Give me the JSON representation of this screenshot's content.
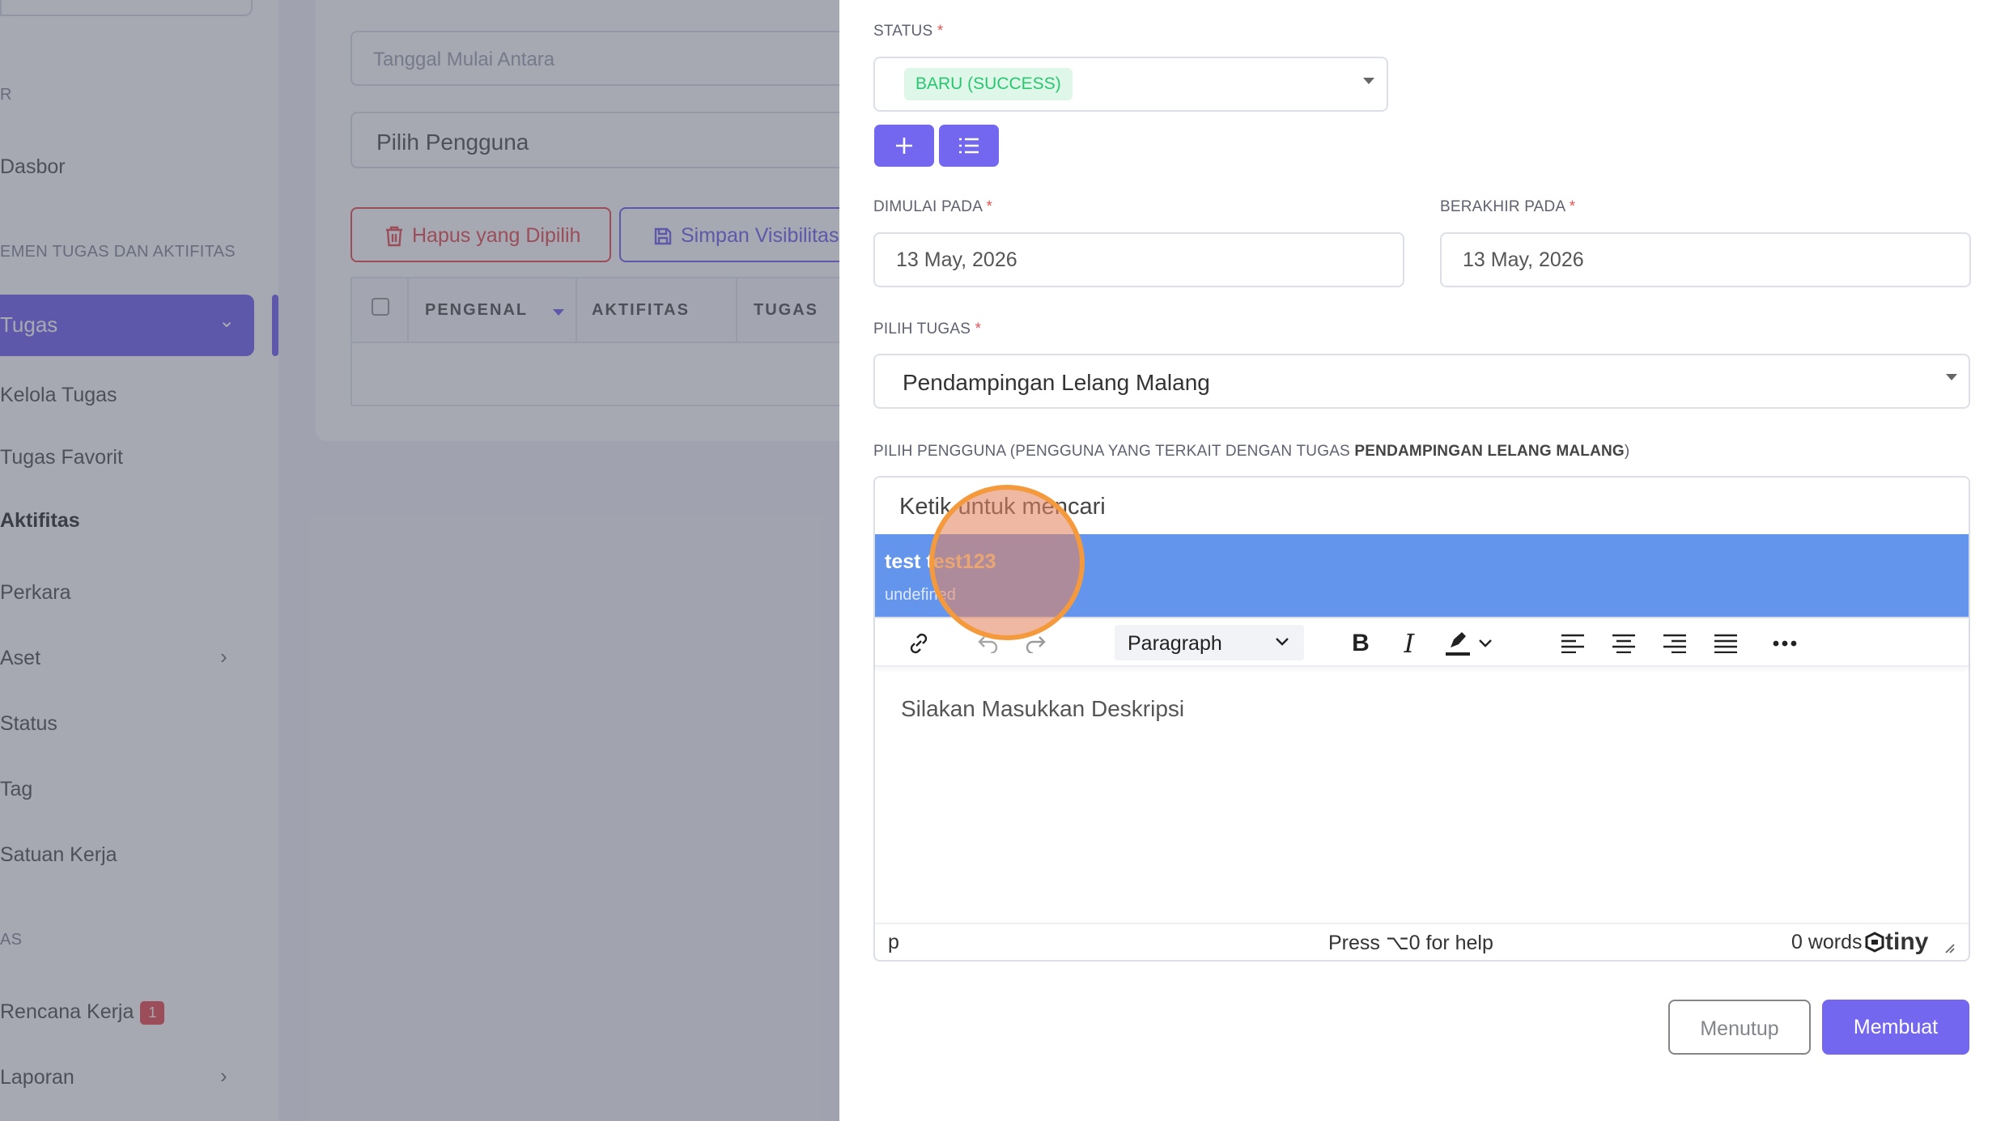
{
  "sidebar": {
    "section_1": "R",
    "dashboard": "Dasbor",
    "section_2": "EMEN TUGAS DAN AKTIFITAS",
    "tasks": "Tugas",
    "manage_tasks": "Kelola Tugas",
    "favorite_tasks": "Tugas Favorit",
    "activities": "Aktifitas",
    "cases": "Perkara",
    "assets": "Aset",
    "status": "Status",
    "tag": "Tag",
    "work_unit": "Satuan Kerja",
    "section_3": "AS",
    "work_plan": "Rencana Kerja",
    "work_plan_badge": "1",
    "reports": "Laporan"
  },
  "background": {
    "date_filter_placeholder": "Tanggal Mulai Antara",
    "user_filter_placeholder": "Pilih Pengguna",
    "delete_selected": "Hapus yang Dipilih",
    "save_visibility": "Simpan Visibilitas",
    "columns": [
      "PENGENAL",
      "AKTIFITAS",
      "TUGAS"
    ]
  },
  "form": {
    "status_label": "STATUS",
    "status_value": "BARU (SUCCESS)",
    "start_label": "DIMULAI PADA",
    "start_value": "13 May, 2026",
    "end_label": "BERAKHIR PADA",
    "end_value": "13 May, 2026",
    "task_label": "PILIH TUGAS",
    "task_value": "Pendampingan Lelang Malang",
    "user_label_prefix": "PILIH PENGGUNA (PENGGUNA YANG TERKAIT DENGAN TUGAS ",
    "user_label_task": "PENDAMPINGAN LELANG MALANG",
    "user_label_suffix": ")",
    "user_search_placeholder": "Ketik untuk mencari",
    "option_name_plain": "test t",
    "option_name_match": "est123",
    "option_sub": "undefined",
    "required_mark": "*"
  },
  "editor": {
    "block_format": "Paragraph",
    "placeholder": "Silakan Masukkan Deskripsi",
    "path": "p",
    "help": "Press ⌥0 for help",
    "word_count": "0 words",
    "brand": "tiny"
  },
  "actions": {
    "close": "Menutup",
    "create": "Membuat"
  },
  "colors": {
    "primary": "#7367f0",
    "danger": "#ea5455",
    "success": "#28c76f",
    "highlight_option": "#6495ed",
    "click_marker": "#f59a3c"
  }
}
